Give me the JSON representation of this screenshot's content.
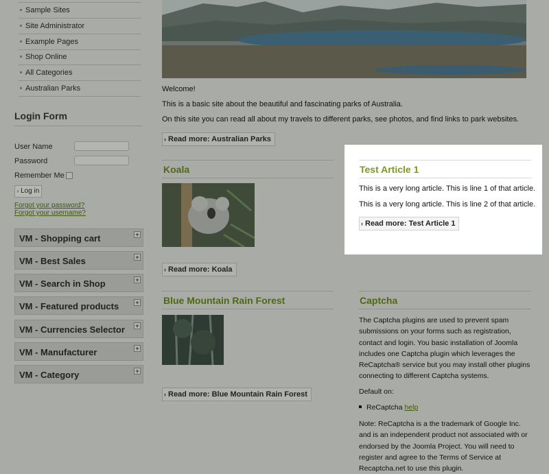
{
  "nav": {
    "items": [
      {
        "label": "Sample Sites"
      },
      {
        "label": "Site Administrator"
      },
      {
        "label": "Example Pages"
      },
      {
        "label": "Shop Online"
      },
      {
        "label": "All Categories"
      },
      {
        "label": "Australian Parks"
      }
    ]
  },
  "login": {
    "title": "Login Form",
    "username_label": "User Name",
    "password_label": "Password",
    "remember_label": "Remember Me",
    "login_button": "Log in",
    "forgot_password": "Forgot your password?",
    "forgot_username": "Forgot your username?"
  },
  "vm_modules": [
    {
      "label": "VM - Shopping cart"
    },
    {
      "label": "VM - Best Sales"
    },
    {
      "label": "VM - Search in Shop"
    },
    {
      "label": "VM - Featured products"
    },
    {
      "label": "VM - Currencies Selector"
    },
    {
      "label": "VM - Manufacturer"
    },
    {
      "label": "VM - Category"
    }
  ],
  "main": {
    "welcome": "Welcome!",
    "intro1": "This is a basic site about the beautiful and fascinating parks of Australia.",
    "intro2": "On this site you can read all about my travels to different parks, see photos, and find links to park websites.",
    "read_more_parks": "Read more: Australian Parks"
  },
  "articles": {
    "koala": {
      "title": "Koala",
      "read_more": "Read more: Koala"
    },
    "test": {
      "title": "Test Article 1",
      "line1": "This is a very long article. This is line 1 of that article.",
      "line2": "This is a very long article. This is line 2 of that article.",
      "read_more": "Read more: Test Article 1"
    },
    "blue_mountain": {
      "title": "Blue Mountain Rain Forest",
      "read_more": "Read more: Blue Mountain Rain Forest"
    },
    "captcha": {
      "title": "Captcha",
      "p1": "The Captcha plugins are used to prevent spam submissions on your forms such as registration, contact and login. You basic installation of Joomla includes one Captcha plugin which leverages the ReCaptcha® service but you may install other plugins connecting to different Captcha systems.",
      "default_on": "Default on:",
      "bullet_text": "ReCaptcha",
      "help_link": "help",
      "note": "Note: ReCaptcha is a the trademark of Google Inc. and is an independent product not associated with or endorsed by the Joomla Project. You will need to register and agree to the Terms of Service at Recaptcha.net to use this plugin."
    }
  },
  "colors": {
    "highlight": "#ffffff",
    "title_green": "#7a9a1f",
    "page_gray": "#a9aba6"
  }
}
